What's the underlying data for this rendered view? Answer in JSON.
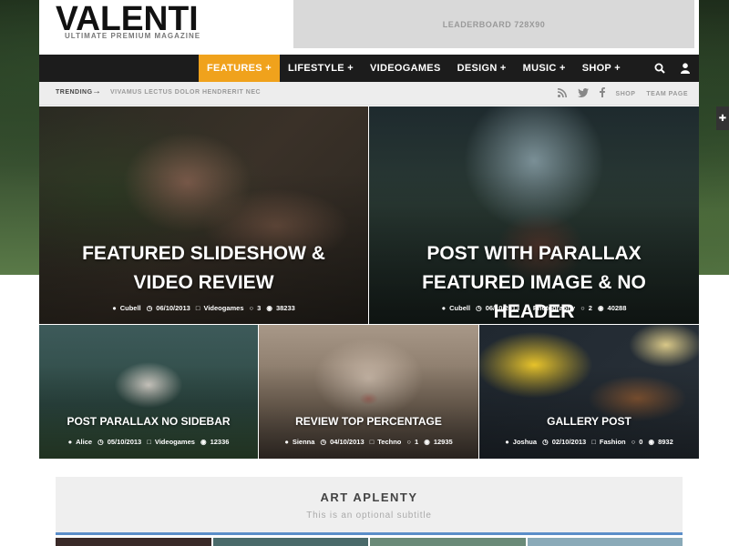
{
  "header": {
    "logo": "VALENTI",
    "tagline": "ULTIMATE PREMIUM MAGAZINE",
    "leaderboard": "LEADERBOARD 728X90"
  },
  "nav": {
    "items": [
      {
        "label": "FEATURES +"
      },
      {
        "label": "LIFESTYLE +"
      },
      {
        "label": "VIDEOGAMES"
      },
      {
        "label": "DESIGN +"
      },
      {
        "label": "MUSIC +"
      },
      {
        "label": "SHOP +"
      }
    ],
    "accent": "#f0a21c"
  },
  "trending": {
    "label": "TRENDING",
    "arrow": "→",
    "text": "VIVAMUS LECTUS DOLOR HENDRERIT NEC",
    "links": [
      "SHOP",
      "TEAM PAGE"
    ]
  },
  "posts": [
    {
      "title": "FEATURED SLIDESHOW & VIDEO REVIEW",
      "author": "Cubell",
      "date": "06/10/2013",
      "category": "Videogames",
      "comments": "3",
      "views": "38233"
    },
    {
      "title": "POST WITH PARALLAX FEATURED IMAGE & NO HEADER",
      "author": "Cubell",
      "date": "06/10/2013",
      "category": "Photography",
      "comments": "2",
      "views": "40288"
    },
    {
      "title": "POST PARALLAX NO SIDEBAR",
      "author": "Alice",
      "date": "05/10/2013",
      "category": "Videogames",
      "views": "12336"
    },
    {
      "title": "REVIEW TOP PERCENTAGE",
      "author": "Sienna",
      "date": "04/10/2013",
      "category": "Techno",
      "comments": "1",
      "views": "12935"
    },
    {
      "title": "GALLERY POST",
      "author": "Joshua",
      "date": "02/10/2013",
      "category": "Fashion",
      "comments": "0",
      "views": "8932"
    }
  ],
  "section": {
    "title": "ART APLENTY",
    "subtitle": "This is an optional subtitle",
    "accent": "#5b8ec9"
  }
}
